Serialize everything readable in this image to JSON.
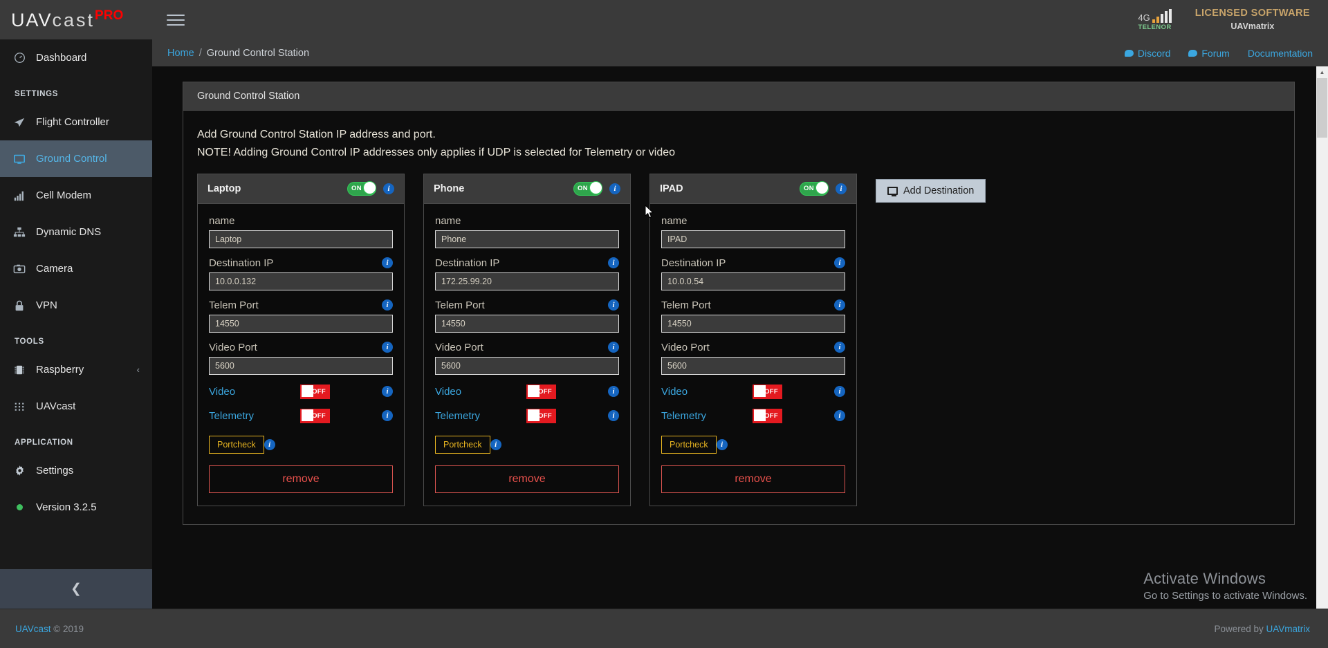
{
  "header": {
    "logo": {
      "part1": "UAV",
      "part2": "cast",
      "part3": "PRO"
    },
    "menu_icon": "hamburger-icon",
    "signal": {
      "network": "4G",
      "carrier": "TELENOR"
    },
    "license": {
      "line1": "LICENSED SOFTWARE",
      "line2": "UAVmatrix"
    }
  },
  "breadcrumb": {
    "home": "Home",
    "separator": "/",
    "current": "Ground Control Station",
    "links": [
      {
        "label": "Discord",
        "icon": "chat-bubble-icon"
      },
      {
        "label": "Forum",
        "icon": "chat-bubble-icon"
      },
      {
        "label": "Documentation",
        "icon": ""
      }
    ]
  },
  "sidebar": {
    "items": [
      {
        "label": "Dashboard",
        "icon": "gauge-icon",
        "active": false
      },
      {
        "label": "Flight Controller",
        "icon": "paper-plane-icon",
        "active": false
      },
      {
        "label": "Ground Control",
        "icon": "monitor-icon",
        "active": true
      },
      {
        "label": "Cell Modem",
        "icon": "signal-bars-icon",
        "active": false
      },
      {
        "label": "Dynamic DNS",
        "icon": "sitemap-icon",
        "active": false
      },
      {
        "label": "Camera",
        "icon": "camera-icon",
        "active": false
      },
      {
        "label": "VPN",
        "icon": "lock-icon",
        "active": false
      },
      {
        "label": "Raspberry",
        "icon": "chip-icon",
        "active": false,
        "chevron": "‹"
      },
      {
        "label": "UAVcast",
        "icon": "grid-dots-icon",
        "active": false
      },
      {
        "label": "Settings",
        "icon": "gear-icon",
        "active": false
      },
      {
        "label": "Version 3.2.5",
        "icon": "status-dot-icon",
        "active": false
      }
    ],
    "captions": {
      "settings": "SETTINGS",
      "tools": "TOOLS",
      "application": "APPLICATION"
    },
    "collapse_icon": "chevron-left-icon"
  },
  "panel": {
    "title": "Ground Control Station",
    "description_line1": "Add Ground Control Station IP address and port.",
    "description_line2": "NOTE! Adding Ground Control IP addresses only applies if UDP is selected for Telemetry or video",
    "add_button": {
      "label": "Add Destination",
      "icon": "monitor-icon"
    }
  },
  "labels": {
    "name": "name",
    "destination_ip": "Destination IP",
    "telem_port": "Telem Port",
    "video_port": "Video Port",
    "video": "Video",
    "telemetry": "Telemetry",
    "portcheck": "Portcheck",
    "remove": "remove",
    "toggle_on": "ON",
    "toggle_off": "OFF"
  },
  "cards": [
    {
      "title": "Laptop",
      "enabled": true,
      "name_value": "Laptop",
      "destination_ip": "10.0.0.132",
      "telem_port": "14550",
      "video_port": "5600",
      "video_enabled": false,
      "telemetry_enabled": false
    },
    {
      "title": "Phone",
      "enabled": true,
      "name_value": "Phone",
      "destination_ip": "172.25.99.20",
      "telem_port": "14550",
      "video_port": "5600",
      "video_enabled": false,
      "telemetry_enabled": false
    },
    {
      "title": "IPAD",
      "enabled": true,
      "name_value": "IPAD",
      "destination_ip": "10.0.0.54",
      "telem_port": "14550",
      "video_port": "5600",
      "video_enabled": false,
      "telemetry_enabled": false
    }
  ],
  "watermark": {
    "line1": "Activate Windows",
    "line2": "Go to Settings to activate Windows."
  },
  "footer": {
    "left_link": "UAVcast",
    "left_text": " © 2019",
    "right_text": "Powered by ",
    "right_link": "UAVmatrix"
  }
}
